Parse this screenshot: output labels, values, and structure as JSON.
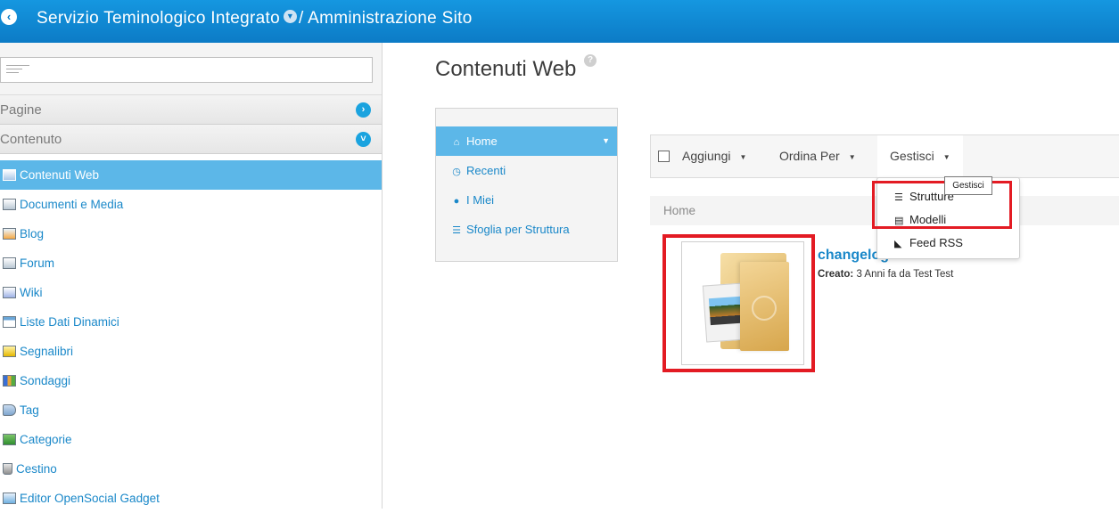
{
  "header": {
    "back_icon": "chevron-left-icon",
    "site_name": "Servizio Teminologico Integrato",
    "separator": "/",
    "section": "Amministrazione Sito"
  },
  "sidebar": {
    "search": {
      "value": "",
      "placeholder": ""
    },
    "sections": [
      {
        "label": "Pagine",
        "state": "collapsed"
      },
      {
        "label": "Contenuto",
        "state": "expanded"
      }
    ],
    "items": [
      {
        "label": "Contenuti Web",
        "icon": "web-content-icon",
        "active": true
      },
      {
        "label": "Documenti e Media",
        "icon": "documents-media-icon"
      },
      {
        "label": "Blog",
        "icon": "blog-icon"
      },
      {
        "label": "Forum",
        "icon": "forum-icon"
      },
      {
        "label": "Wiki",
        "icon": "wiki-icon"
      },
      {
        "label": "Liste Dati Dinamici",
        "icon": "dynamic-data-lists-icon"
      },
      {
        "label": "Segnalibri",
        "icon": "bookmarks-icon"
      },
      {
        "label": "Sondaggi",
        "icon": "polls-icon"
      },
      {
        "label": "Tag",
        "icon": "tag-icon"
      },
      {
        "label": "Categorie",
        "icon": "categories-icon"
      },
      {
        "label": "Cestino",
        "icon": "trash-icon"
      },
      {
        "label": "Editor OpenSocial Gadget",
        "icon": "gadget-icon"
      }
    ]
  },
  "main": {
    "title": "Contenuti Web",
    "help_icon": "help-icon",
    "left_menu": [
      {
        "label": "Home",
        "icon": "home-icon",
        "active": true
      },
      {
        "label": "Recenti",
        "icon": "clock-icon"
      },
      {
        "label": "I Miei",
        "icon": "user-icon"
      },
      {
        "label": "Sfoglia per Struttura",
        "icon": "list-icon"
      }
    ],
    "toolbar": {
      "add_label": "Aggiungi",
      "sort_label": "Ordina Per",
      "manage_label": "Gestisci",
      "tooltip": "Gestisci"
    },
    "manage_menu": [
      {
        "label": "Strutture",
        "icon": "structures-icon"
      },
      {
        "label": "Modelli",
        "icon": "templates-icon"
      },
      {
        "label": "Feed RSS",
        "icon": "rss-icon"
      }
    ],
    "breadcrumb": "Home",
    "article": {
      "title": "changelog",
      "created_label": "Creato:",
      "created_value": "3 Anni fa da Test Test",
      "thumbnail_icon": "folder-image-icon"
    }
  },
  "colors": {
    "header_bar": "#0c7bc6",
    "accent_link": "#1a88c9",
    "active_item": "#5cb7e8",
    "highlight_box": "#e31b23"
  }
}
